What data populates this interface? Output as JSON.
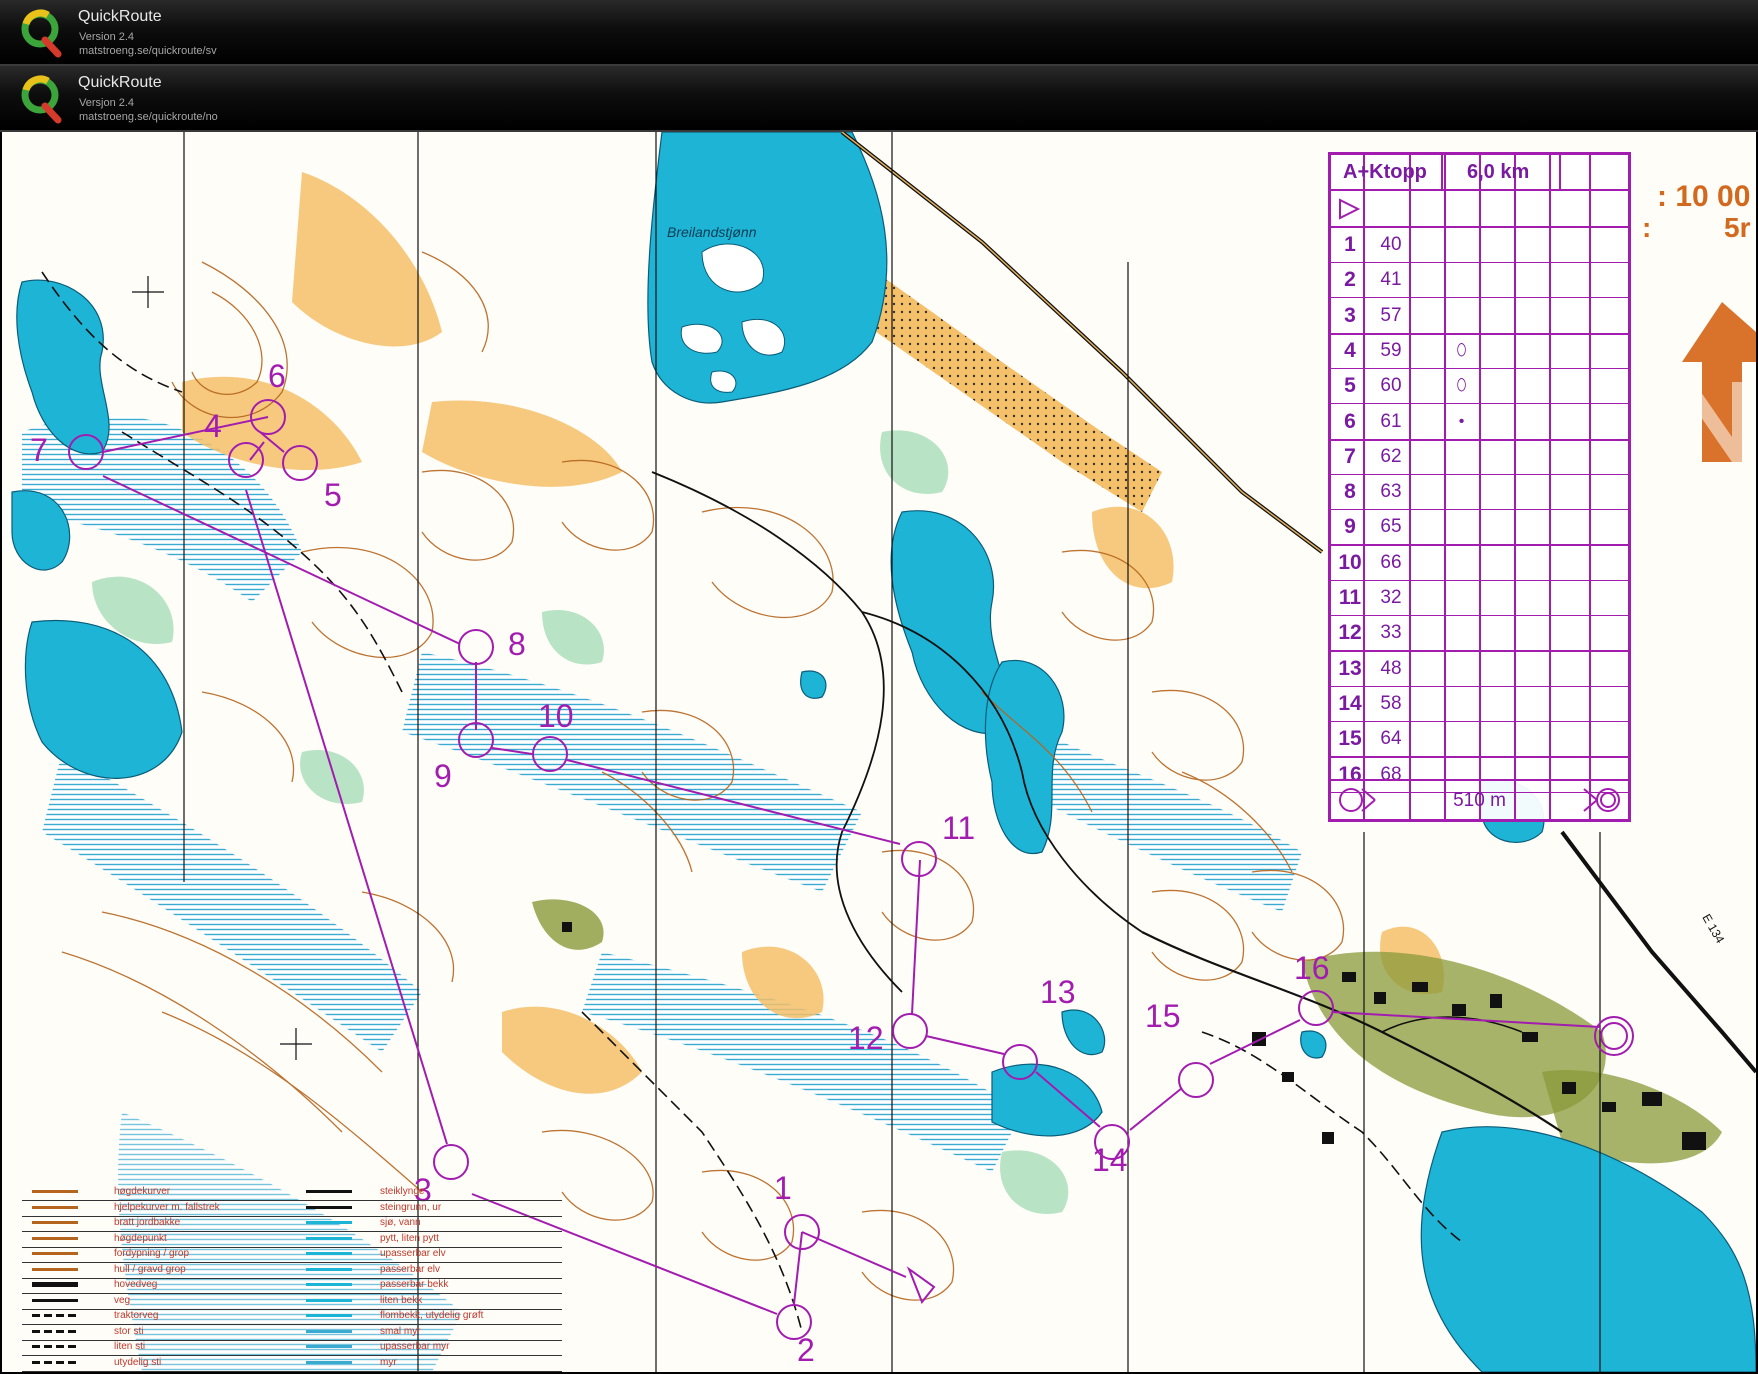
{
  "headers": [
    {
      "name": "QuickRoute",
      "version": "Version 2.4",
      "url": "matstroeng.se/quickroute/sv"
    },
    {
      "name": "QuickRoute",
      "version": "Versjon 2.4",
      "url": "matstroeng.se/quickroute/no"
    }
  ],
  "map": {
    "lake_label": "Breilandstjønn",
    "road_label": "E 134",
    "scale_partial": ": 10 00",
    "contour_partial": ":",
    "contour_partial_value": "5r"
  },
  "course_table": {
    "name": "A+Ktopp",
    "length": "6,0 km",
    "controls": [
      {
        "seq": "1",
        "code": "40",
        "symbol": ""
      },
      {
        "seq": "2",
        "code": "41",
        "symbol": ""
      },
      {
        "seq": "3",
        "code": "57",
        "symbol": ""
      },
      {
        "seq": "4",
        "code": "59",
        "symbol": "⬯"
      },
      {
        "seq": "5",
        "code": "60",
        "symbol": "⬯"
      },
      {
        "seq": "6",
        "code": "61",
        "symbol": "•"
      },
      {
        "seq": "7",
        "code": "62",
        "symbol": ""
      },
      {
        "seq": "8",
        "code": "63",
        "symbol": ""
      },
      {
        "seq": "9",
        "code": "65",
        "symbol": ""
      },
      {
        "seq": "10",
        "code": "66",
        "symbol": ""
      },
      {
        "seq": "11",
        "code": "32",
        "symbol": ""
      },
      {
        "seq": "12",
        "code": "33",
        "symbol": ""
      },
      {
        "seq": "13",
        "code": "48",
        "symbol": ""
      },
      {
        "seq": "14",
        "code": "58",
        "symbol": ""
      },
      {
        "seq": "15",
        "code": "64",
        "symbol": ""
      },
      {
        "seq": "16",
        "code": "68",
        "symbol": ""
      }
    ],
    "finish_distance": "510 m"
  },
  "control_labels": [
    "1",
    "2",
    "3",
    "4",
    "5",
    "6",
    "7",
    "8",
    "9",
    "10",
    "11",
    "12",
    "13",
    "14",
    "15",
    "16"
  ],
  "legend": [
    {
      "left": "høgdekurver",
      "right": "steiklynge"
    },
    {
      "left": "hjelpekurver m. fallstrek",
      "right": "steingrunn, ur"
    },
    {
      "left": "bratt jordbakke",
      "right": "sjø, vann"
    },
    {
      "left": "høgdepunkt",
      "right": "pytt, liten pytt"
    },
    {
      "left": "fordypning / grop",
      "right": "upasserbar elv"
    },
    {
      "left": "hull / gravd grop",
      "right": "passerbar elv"
    },
    {
      "left": "hovedveg",
      "right": "passerbar bekk"
    },
    {
      "left": "veg",
      "right": "liten bekk"
    },
    {
      "left": "traktorveg",
      "right": "flombekk, utydelig grøft"
    },
    {
      "left": "stor sti",
      "right": "smal myr"
    },
    {
      "left": "liten sti",
      "right": "upasserbar myr"
    },
    {
      "left": "utydelig sti",
      "right": "myr"
    }
  ],
  "colors": {
    "course": "#a21caf",
    "water": "#1eb4d6",
    "open_land": "#f5c06a",
    "contour": "#b5651d",
    "marsh": "#3aaad0",
    "green": "#7ecf9a",
    "settlement": "#8a9a3a",
    "header_bg": "#000000"
  }
}
